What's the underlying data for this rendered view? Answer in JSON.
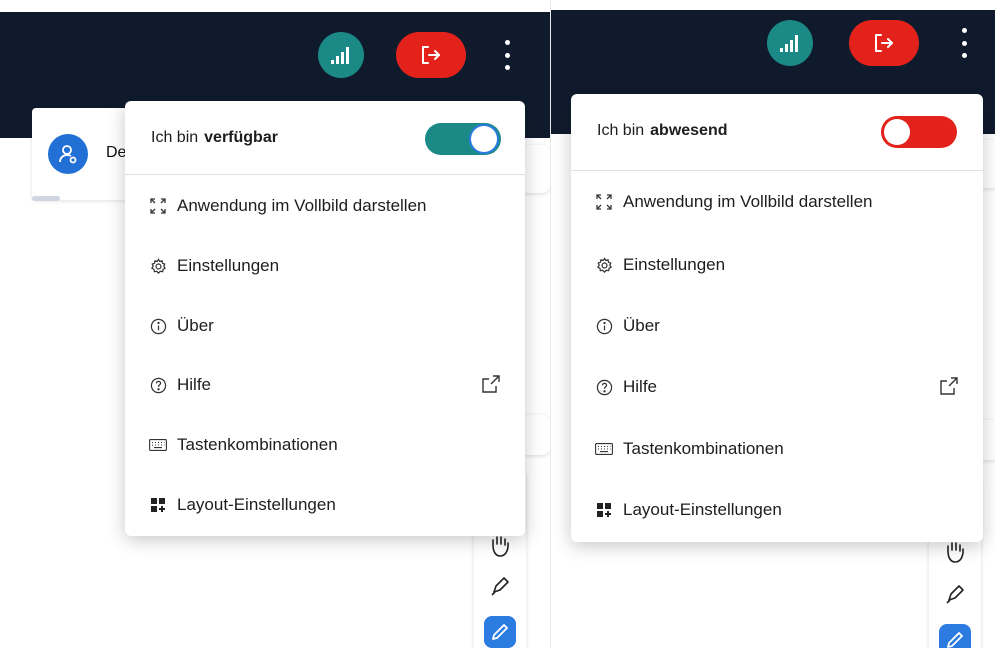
{
  "colors": {
    "topbar": "#0f1b2d",
    "signal": "#1b8a86",
    "leave": "#e3231b",
    "toggle_on": "#1b8a86",
    "toggle_off": "#e3231b",
    "avatar": "#2270d6",
    "active_tool": "#2b7be0"
  },
  "left": {
    "user_card": {
      "name_partial": "De"
    },
    "menu": {
      "status_prefix": "Ich bin",
      "status_value": "verfügbar",
      "toggle_state": "on",
      "items": [
        {
          "label": "Anwendung im Vollbild darstellen",
          "icon": "fullscreen-icon"
        },
        {
          "label": "Einstellungen",
          "icon": "gear-icon"
        },
        {
          "label": "Über",
          "icon": "info-icon"
        },
        {
          "label": "Hilfe",
          "icon": "help-icon"
        },
        {
          "label": "Tastenkombinationen",
          "icon": "keyboard-icon"
        },
        {
          "label": "Layout-Einstellungen",
          "icon": "layout-icon"
        }
      ]
    }
  },
  "right": {
    "menu": {
      "status_prefix": "Ich bin",
      "status_value": "abwesend",
      "toggle_state": "off",
      "items": [
        {
          "label": "Anwendung im Vollbild darstellen",
          "icon": "fullscreen-icon"
        },
        {
          "label": "Einstellungen",
          "icon": "gear-icon"
        },
        {
          "label": "Über",
          "icon": "info-icon"
        },
        {
          "label": "Hilfe",
          "icon": "help-icon"
        },
        {
          "label": "Tastenkombinationen",
          "icon": "keyboard-icon"
        },
        {
          "label": "Layout-Einstellungen",
          "icon": "layout-icon"
        }
      ]
    }
  }
}
